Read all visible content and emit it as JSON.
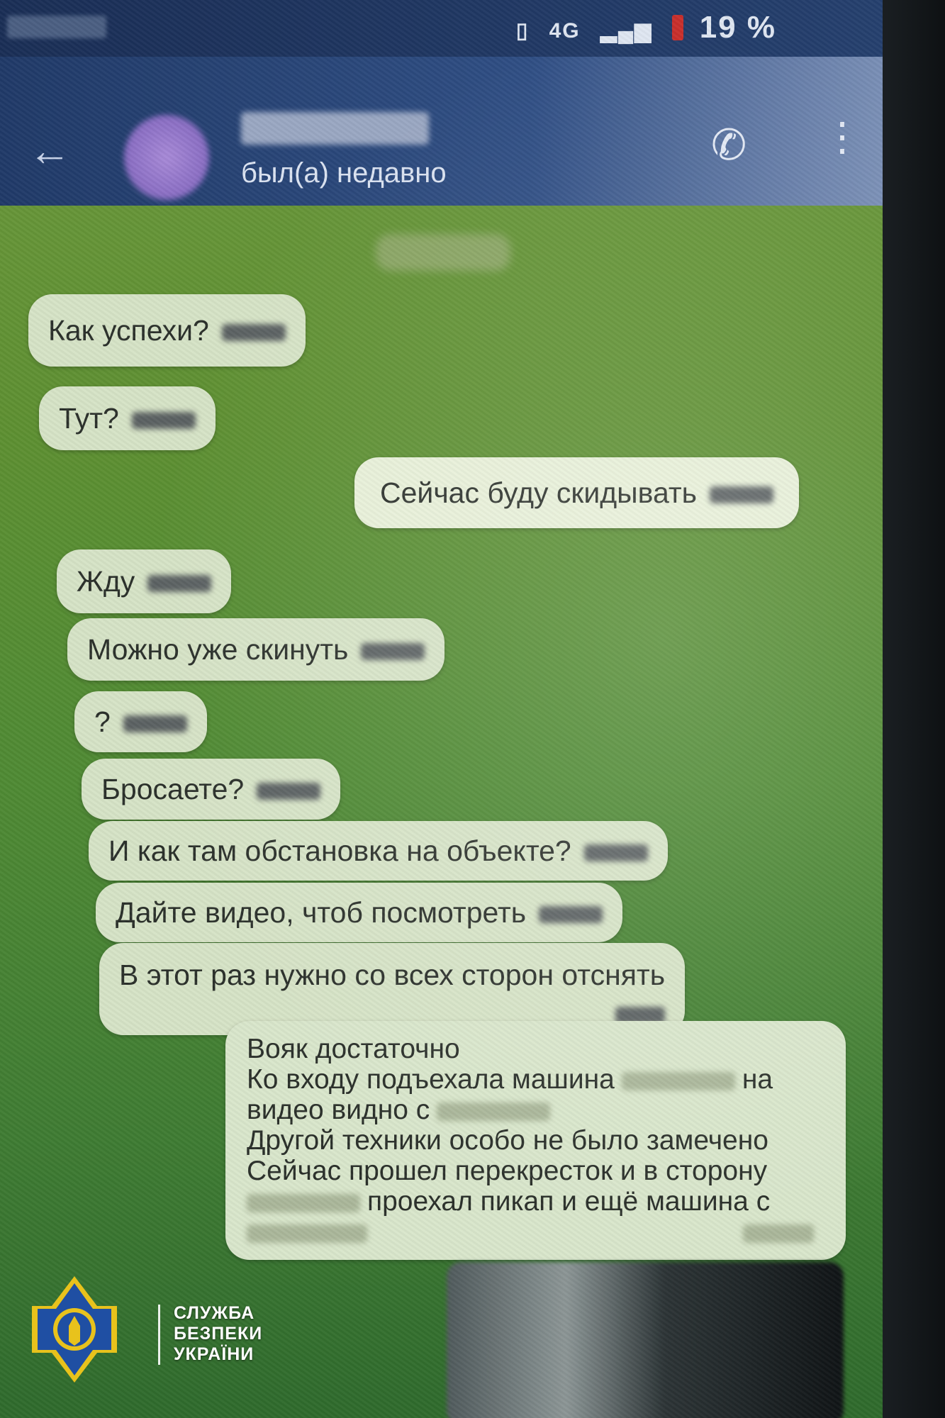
{
  "status_bar": {
    "battery": "19 %",
    "network": "4G"
  },
  "chat_header": {
    "contact_status": "был(а) недавно"
  },
  "messages": [
    {
      "text": "Как успехи?",
      "direction": "in"
    },
    {
      "text": "Тут?",
      "direction": "in"
    },
    {
      "text": "Сейчас буду скидывать",
      "direction": "out"
    },
    {
      "text": "Жду",
      "direction": "in"
    },
    {
      "text": "Можно уже скинуть",
      "direction": "in"
    },
    {
      "text": "?",
      "direction": "in"
    },
    {
      "text": "Бросаете?",
      "direction": "in"
    },
    {
      "text": "И как там обстановка на объекте?",
      "direction": "in"
    },
    {
      "text": "Дайте видео, чтоб посмотреть",
      "direction": "in"
    },
    {
      "text": "В этот раз нужно со всех сторон отснять",
      "direction": "in"
    }
  ],
  "report_message": {
    "line1": "Вояк достаточно",
    "line2": "Ко входу подъехала машина",
    "line2_tail": "на",
    "line3": "видео видно с",
    "line4": "Другой техники особо не было замечено",
    "line5": "Сейчас прошел перекресток и в сторону",
    "line6": "проехал пикап и ещё машина с"
  },
  "watermark": {
    "line1": "СЛУЖБА",
    "line2": "БЕЗПЕКИ",
    "line3": "УКРАЇНИ"
  },
  "colors": {
    "chat_bg": "#5e9032",
    "header_bg": "#2f4e84",
    "bubble": "#d6e3c6",
    "sbu_blue": "#1f4fa3",
    "sbu_gold": "#e8c21c"
  }
}
